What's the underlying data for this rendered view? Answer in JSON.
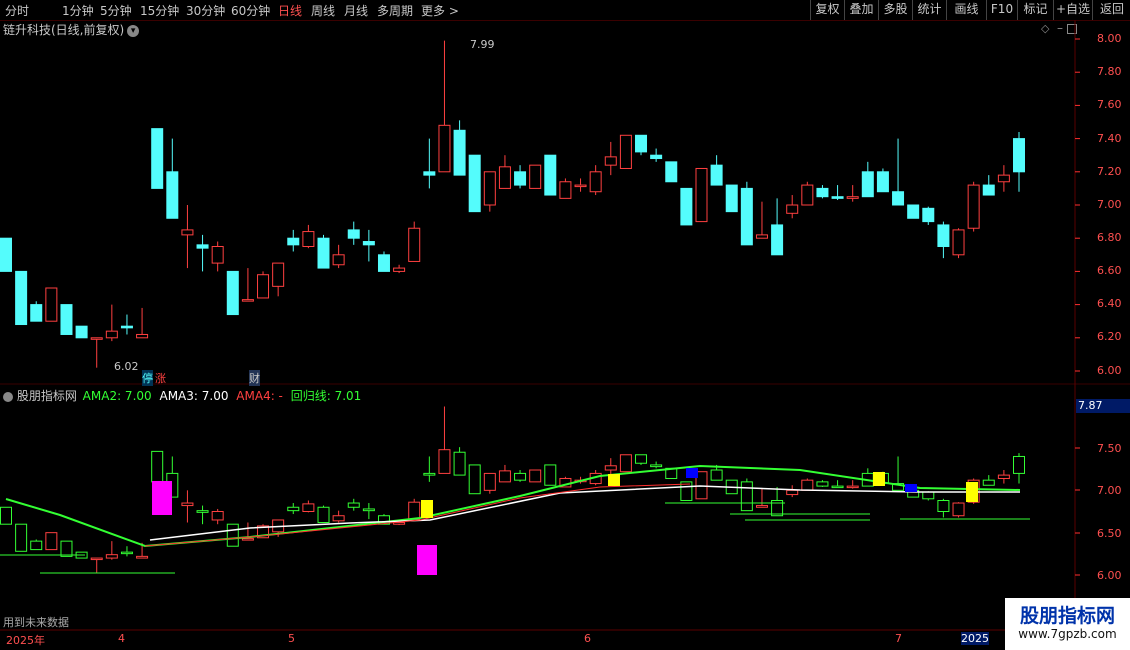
{
  "toolbar": {
    "periods": [
      "分时",
      "1分钟",
      "5分钟",
      "15分钟",
      "30分钟",
      "60分钟",
      "日线",
      "周线",
      "月线",
      "多周期",
      "更多 >"
    ],
    "active_period": "日线",
    "right_buttons": [
      "复权",
      "叠加",
      "多股",
      "统计",
      "画线",
      "F10",
      "标记",
      "+自选",
      "返回"
    ]
  },
  "chart_title": "链升科技(日线,前复权)",
  "price_axis": [
    "8.00",
    "7.80",
    "7.60",
    "7.40",
    "7.20",
    "7.00",
    "6.80",
    "6.60",
    "6.40",
    "6.20",
    "6.00"
  ],
  "price_high_label": "7.99",
  "price_low_label": "6.02",
  "event_badges": {
    "limit_a": "停",
    "limit_b": "涨",
    "finance": "财"
  },
  "indicator": {
    "name": "股朋指标网",
    "ama2": "AMA2: 7.00",
    "ama3": "AMA3: 7.00",
    "ama4": "AMA4: -",
    "huigui": "回归线: 7.01",
    "current_value": "7.87",
    "axis": [
      "7.50",
      "7.00",
      "6.50",
      "6.00"
    ]
  },
  "footer_note": "用到未来数据",
  "date_axis": {
    "year_start": "2025年",
    "m4": "4",
    "m5": "5",
    "m6": "6",
    "m7": "7",
    "year_end": "2025"
  },
  "watermark": {
    "name": "股朋指标网",
    "url": "www.7gpzb.com"
  },
  "colors": {
    "up": "#ff4040",
    "down": "#54fcfc",
    "bg": "#000000",
    "grid": "#3a0000"
  },
  "chart_data": {
    "type": "candlestick",
    "ylim": [
      5.95,
      8.05
    ],
    "candles": [
      [
        6.8,
        6.8,
        6.6,
        6.6
      ],
      [
        6.6,
        6.6,
        6.28,
        6.28
      ],
      [
        6.4,
        6.42,
        6.3,
        6.3
      ],
      [
        6.3,
        6.5,
        6.3,
        6.5
      ],
      [
        6.4,
        6.4,
        6.22,
        6.22
      ],
      [
        6.27,
        6.27,
        6.2,
        6.2
      ],
      [
        6.2,
        6.2,
        6.02,
        6.2
      ],
      [
        6.2,
        6.4,
        6.18,
        6.24
      ],
      [
        6.27,
        6.34,
        6.22,
        6.26
      ],
      [
        6.2,
        6.38,
        6.2,
        6.22
      ],
      [
        7.46,
        7.46,
        7.1,
        7.1
      ],
      [
        7.2,
        7.4,
        6.92,
        6.92
      ],
      [
        6.82,
        7.0,
        6.62,
        6.85
      ],
      [
        6.76,
        6.82,
        6.6,
        6.74
      ],
      [
        6.65,
        6.78,
        6.6,
        6.75
      ],
      [
        6.6,
        6.6,
        6.34,
        6.34
      ],
      [
        6.43,
        6.62,
        6.42,
        6.43
      ],
      [
        6.44,
        6.6,
        6.44,
        6.58
      ],
      [
        6.51,
        6.65,
        6.45,
        6.65
      ],
      [
        6.8,
        6.85,
        6.72,
        6.76
      ],
      [
        6.75,
        6.88,
        6.74,
        6.84
      ],
      [
        6.8,
        6.82,
        6.62,
        6.62
      ],
      [
        6.64,
        6.76,
        6.62,
        6.7
      ],
      [
        6.85,
        6.9,
        6.76,
        6.8
      ],
      [
        6.78,
        6.85,
        6.66,
        6.76
      ],
      [
        6.7,
        6.72,
        6.6,
        6.6
      ],
      [
        6.6,
        6.64,
        6.59,
        6.62
      ],
      [
        6.66,
        6.9,
        6.66,
        6.86
      ],
      [
        7.2,
        7.4,
        7.1,
        7.18
      ],
      [
        7.2,
        7.99,
        7.2,
        7.48
      ],
      [
        7.45,
        7.51,
        7.18,
        7.18
      ],
      [
        7.3,
        7.3,
        6.96,
        6.96
      ],
      [
        7.0,
        7.2,
        6.96,
        7.2
      ],
      [
        7.1,
        7.3,
        7.1,
        7.23
      ],
      [
        7.2,
        7.24,
        7.1,
        7.12
      ],
      [
        7.1,
        7.24,
        7.1,
        7.24
      ],
      [
        7.3,
        7.3,
        7.06,
        7.06
      ],
      [
        7.04,
        7.16,
        7.04,
        7.14
      ],
      [
        7.12,
        7.16,
        7.08,
        7.12
      ],
      [
        7.08,
        7.24,
        7.06,
        7.2
      ],
      [
        7.24,
        7.38,
        7.18,
        7.29
      ],
      [
        7.22,
        7.42,
        7.24,
        7.42
      ],
      [
        7.42,
        7.42,
        7.3,
        7.32
      ],
      [
        7.3,
        7.34,
        7.26,
        7.28
      ],
      [
        7.26,
        7.26,
        7.14,
        7.14
      ],
      [
        7.1,
        7.1,
        6.88,
        6.88
      ],
      [
        6.9,
        7.22,
        6.9,
        7.22
      ],
      [
        7.24,
        7.3,
        7.12,
        7.12
      ],
      [
        7.12,
        7.12,
        6.96,
        6.96
      ],
      [
        7.1,
        7.14,
        6.76,
        6.76
      ],
      [
        6.8,
        7.02,
        6.8,
        6.82
      ],
      [
        6.88,
        7.04,
        6.8,
        6.7
      ],
      [
        6.95,
        7.06,
        6.92,
        7.0
      ],
      [
        7.0,
        7.14,
        7.04,
        7.12
      ],
      [
        7.1,
        7.12,
        7.04,
        7.05
      ],
      [
        7.05,
        7.12,
        7.03,
        7.04
      ],
      [
        7.04,
        7.12,
        7.02,
        7.05
      ],
      [
        7.2,
        7.26,
        7.05,
        7.05
      ],
      [
        7.2,
        7.22,
        7.08,
        7.08
      ],
      [
        7.08,
        7.4,
        7.0,
        7.0
      ],
      [
        7.0,
        7.0,
        6.92,
        6.92
      ],
      [
        6.98,
        6.99,
        6.88,
        6.9
      ],
      [
        6.88,
        6.9,
        6.68,
        6.75
      ],
      [
        6.7,
        6.86,
        6.68,
        6.85
      ],
      [
        6.86,
        7.14,
        6.84,
        7.12
      ],
      [
        7.12,
        7.18,
        7.06,
        7.06
      ],
      [
        7.14,
        7.24,
        7.08,
        7.18
      ],
      [
        7.4,
        7.44,
        7.08,
        7.2
      ]
    ]
  }
}
